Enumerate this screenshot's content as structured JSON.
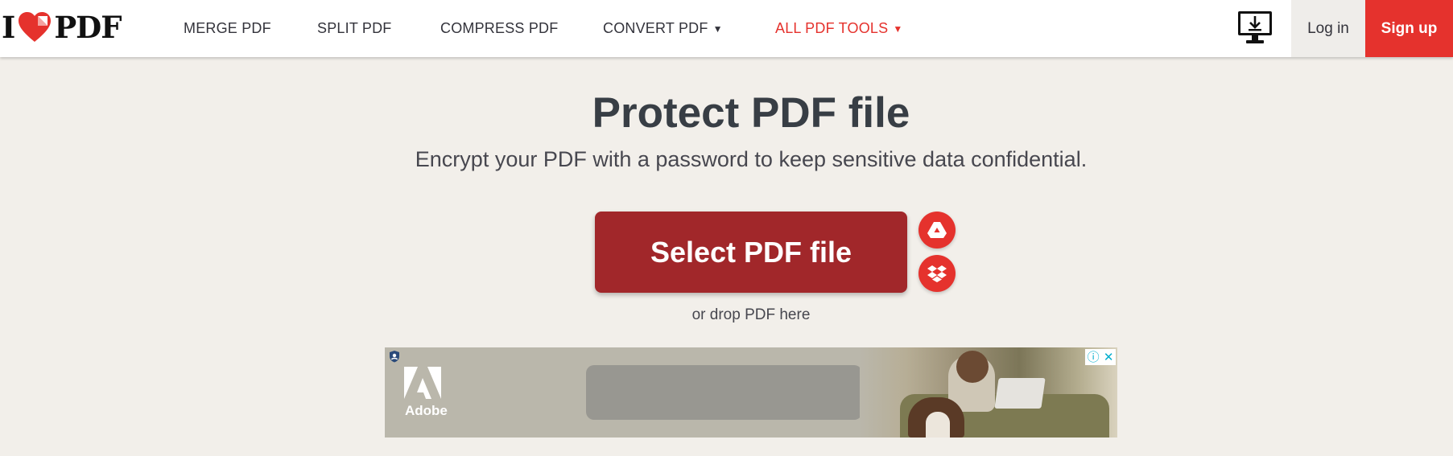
{
  "navbar": {
    "logo_i": "I",
    "logo_pdf": "PDF",
    "links": [
      {
        "label": "MERGE PDF"
      },
      {
        "label": "SPLIT PDF"
      },
      {
        "label": "COMPRESS PDF"
      },
      {
        "label": "CONVERT PDF"
      },
      {
        "label": "ALL PDF TOOLS"
      }
    ],
    "desktop_icon": "desktop-download-icon",
    "login_label": "Log in",
    "signup_label": "Sign up"
  },
  "main": {
    "title": "Protect PDF file",
    "subtitle": "Encrypt your PDF with a password to keep sensitive data confidential.",
    "select_button": "Select PDF file",
    "drop_text": "or drop PDF here",
    "cloud_buttons": [
      "google-drive-icon",
      "dropbox-icon"
    ]
  },
  "ad": {
    "brand": "Adobe"
  },
  "colors": {
    "brand_red": "#e5322d",
    "button_dark_red": "#a1272a",
    "background": "#f2efea",
    "text_dark": "#383e45"
  }
}
